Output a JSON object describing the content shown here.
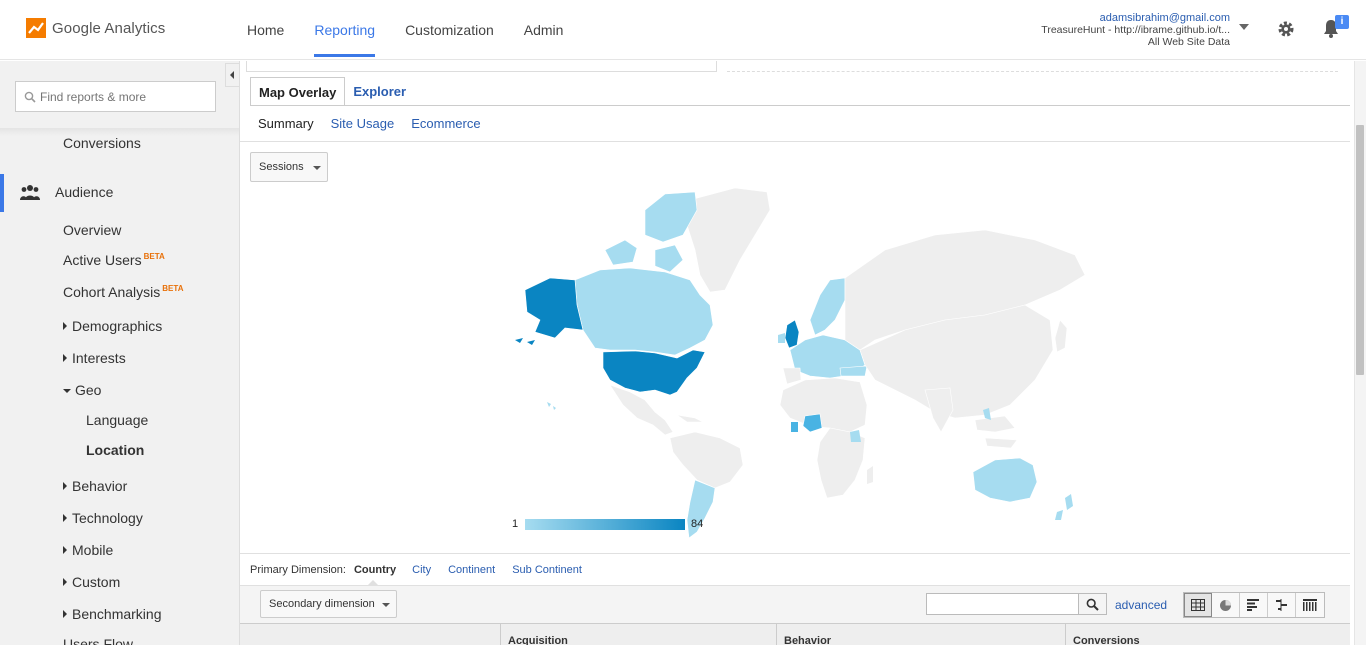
{
  "app": {
    "name": "Google Analytics",
    "nav": [
      "Home",
      "Reporting",
      "Customization",
      "Admin"
    ],
    "active_nav": "Reporting",
    "account": {
      "email": "adamsibrahim@gmail.com",
      "property": "TreasureHunt - http://ibrame.github.io/t...",
      "view": "All Web Site Data"
    },
    "notification_count": "i"
  },
  "sidebar": {
    "search_placeholder": "Find reports & more",
    "conversions": "Conversions",
    "audience": "Audience",
    "overview": "Overview",
    "active_users": "Active Users",
    "cohort_analysis": "Cohort Analysis",
    "beta": "BETA",
    "demographics": "Demographics",
    "interests": "Interests",
    "geo": "Geo",
    "language": "Language",
    "location": "Location",
    "behavior": "Behavior",
    "technology": "Technology",
    "mobile": "Mobile",
    "custom": "Custom",
    "benchmarking": "Benchmarking",
    "users_flow": "Users Flow"
  },
  "tabs": [
    "Map Overlay",
    "Explorer"
  ],
  "subtabs": [
    "Summary",
    "Site Usage",
    "Ecommerce"
  ],
  "metric_select": "Sessions",
  "map": {
    "legend_min": "1",
    "legend_max": "84",
    "color_min": "#a6dcf0",
    "color_max": "#0a85c2",
    "color_none": "#eeeeee"
  },
  "primary_dimension": {
    "label": "Primary Dimension:",
    "active": "Country",
    "options": [
      "City",
      "Continent",
      "Sub Continent"
    ]
  },
  "table": {
    "secondary_dimension": "Secondary dimension",
    "advanced": "advanced",
    "columns": [
      "Acquisition",
      "Behavior",
      "Conversions"
    ]
  }
}
